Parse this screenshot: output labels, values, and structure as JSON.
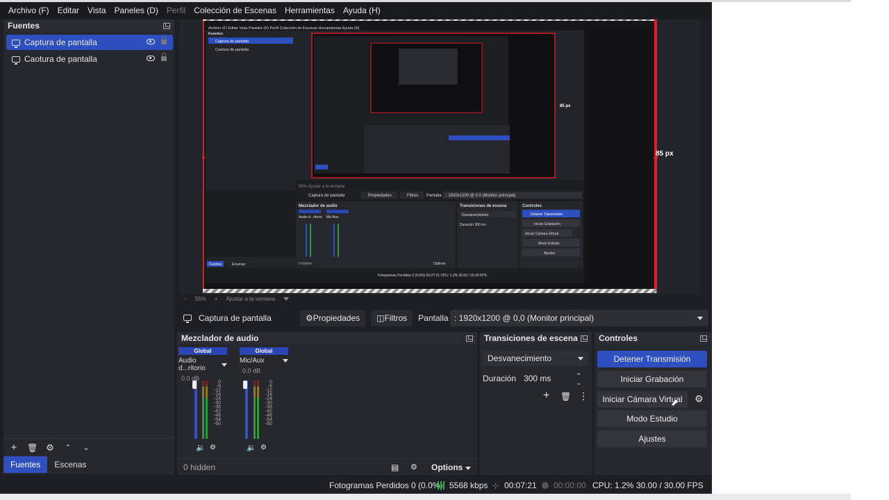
{
  "menu": [
    {
      "label": "Archivo (F)",
      "dim": false
    },
    {
      "label": "Editar",
      "dim": false
    },
    {
      "label": "Vista",
      "dim": false
    },
    {
      "label": "Paneles (D)",
      "dim": false
    },
    {
      "label": "Perfil",
      "dim": true
    },
    {
      "label": "Colección de Escenas",
      "dim": false
    },
    {
      "label": "Herramientas",
      "dim": false
    },
    {
      "label": "Ayuda (H)",
      "dim": false
    }
  ],
  "sources": {
    "title": "Fuentes",
    "items": [
      {
        "label": "Captura de pantalla",
        "selected": true
      },
      {
        "label": "Caotura de pantalla",
        "selected": false
      }
    ],
    "tabs": {
      "sources": "Fuentes",
      "scenes": "Escenas"
    }
  },
  "preview": {
    "px_label_small": "85 px",
    "px_label": "85 px",
    "zoom": "55%",
    "fit": "Ajustar a la ventana",
    "inner_menu": [
      "Archivo (F)",
      "Editar",
      "Vista",
      "Paneles (D)",
      "Perfil",
      "Colección de Escenas",
      "Herramientas",
      "Ayuda (H)"
    ],
    "inner_sources": [
      "Captura de pantalla",
      "Caotura de pantalla"
    ],
    "inner_prop": {
      "source": "Captura de pantalla",
      "props": "Propiedades",
      "filters": "Filtros",
      "display": "Pantalla",
      "display_value": ": 1920x1200 @ 0,0 (Monitor principal)"
    },
    "inner_mixer_title": "Mezclador de audio",
    "inner_trans_title": "Transiciones de escena",
    "inner_ctrl_title": "Controles",
    "inner_buttons": [
      "Detener Transmisión",
      "Iniciar Grabación",
      "Iniciar Cámara Virtual",
      "Modo Estudio",
      "Ajustes"
    ],
    "inner_trans": "Desvanecimiento",
    "inner_dur_label": "Duración",
    "inner_dur": "300 ms",
    "inner_hidden": "0 hidden",
    "inner_options": "Options",
    "inner_status": "Fotogramas Perdidos 0 (0.0%)",
    "inner_time": "00:07:21",
    "inner_cpu": "CPU: 1.2%",
    "inner_fps": "30.00 / 30.00 FPS",
    "inner_tabs": [
      "Fuentes",
      "Escenas"
    ],
    "inner_ch1": "Audio d...ritorio",
    "inner_ch2": "Mic/Aux",
    "inner_global": "Global"
  },
  "propbar": {
    "source_name": "Captura de pantalla",
    "properties": "Propiedades",
    "filters": "Filtros",
    "display_label": "Pantalla",
    "display_value": ": 1920x1200 @ 0,0 (Monitor principal)"
  },
  "mixer": {
    "title": "Mezclador de audio",
    "channels": [
      {
        "header": "Global",
        "name": "Audio d...ritorio",
        "db": "0.0 dB"
      },
      {
        "header": "Global",
        "name": "Mic/Aux",
        "db": "0.0 dB"
      }
    ],
    "scale": [
      "0",
      "-6",
      "-12",
      "-18",
      "-24",
      "-30",
      "-36",
      "-42",
      "-48",
      "-54",
      "-60"
    ],
    "hidden": "0 hidden",
    "options": "Options"
  },
  "transitions": {
    "title": "Transiciones de escena",
    "selected": "Desvanecimiento",
    "duration_label": "Duración",
    "duration_value": "300 ms"
  },
  "controls": {
    "title": "Controles",
    "stop_stream": "Detener Transmisión",
    "start_recording": "Iniciar Grabación",
    "start_virtualcam": "Iniciar Cámara Virtual",
    "studio_mode": "Modo Estudio",
    "settings": "Ajustes"
  },
  "status": {
    "dropped": "Fotogramas Perdidos 0 (0.0%)",
    "kbps": "5568 kbps",
    "stream_time": "00:07:21",
    "rec_time": "00:00:00",
    "cpu": "CPU: 1.2%",
    "fps": "30.00 / 30.00 FPS"
  },
  "colors": {
    "accent": "#2e4fbf",
    "red_border": "#d71f2a",
    "bg": "#1e1f24"
  }
}
